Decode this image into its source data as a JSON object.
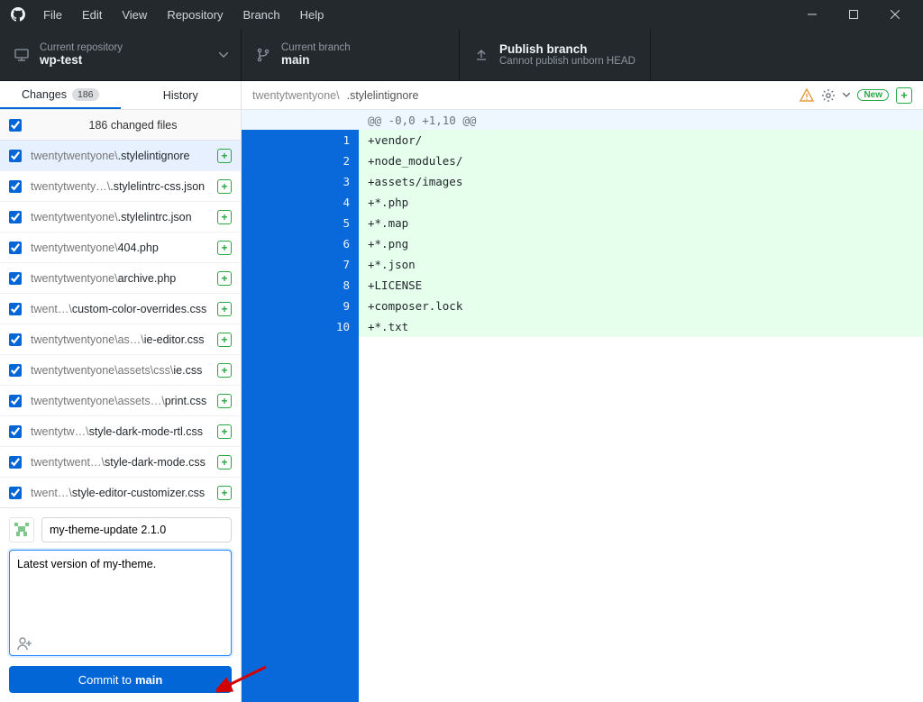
{
  "menu": {
    "file": "File",
    "edit": "Edit",
    "view": "View",
    "repository": "Repository",
    "branch": "Branch",
    "help": "Help"
  },
  "toolbar": {
    "repo_label": "Current repository",
    "repo_value": "wp-test",
    "branch_label": "Current branch",
    "branch_value": "main",
    "publish_title": "Publish branch",
    "publish_sub": "Cannot publish unborn HEAD"
  },
  "tabs": {
    "changes": "Changes",
    "changes_count": "186",
    "history": "History"
  },
  "summary": "186 changed files",
  "files": [
    {
      "dim": "twentytwentyone\\",
      "name": ".stylelintignore",
      "selected": true
    },
    {
      "dim": "twentytwenty…\\",
      "name": ".stylelintrc-css.json"
    },
    {
      "dim": "twentytwentyone\\",
      "name": ".stylelintrc.json"
    },
    {
      "dim": "twentytwentyone\\",
      "name": "404.php"
    },
    {
      "dim": "twentytwentyone\\",
      "name": "archive.php"
    },
    {
      "dim": "twent…\\",
      "name": "custom-color-overrides.css"
    },
    {
      "dim": "twentytwentyone\\as…\\",
      "name": "ie-editor.css"
    },
    {
      "dim": "twentytwentyone\\assets\\css\\",
      "name": "ie.css"
    },
    {
      "dim": "twentytwentyone\\assets…\\",
      "name": "print.css"
    },
    {
      "dim": "twentytw…\\",
      "name": "style-dark-mode-rtl.css"
    },
    {
      "dim": "twentytwent…\\",
      "name": "style-dark-mode.css"
    },
    {
      "dim": "twent…\\",
      "name": "style-editor-customizer.css"
    }
  ],
  "commit": {
    "summary_value": "my-theme-update 2.1.0",
    "description_value": "Latest version of my-theme.",
    "button_prefix": "Commit to ",
    "button_branch": "main"
  },
  "pathbar": {
    "dim": "twentytwentyone\\",
    "name": ".stylelintignore",
    "new": "New"
  },
  "diff": {
    "hunk": "@@ -0,0 +1,10 @@",
    "lines": [
      "+vendor/",
      "+node_modules/",
      "+assets/images",
      "+*.php",
      "+*.map",
      "+*.png",
      "+*.json",
      "+LICENSE",
      "+composer.lock",
      "+*.txt"
    ]
  }
}
